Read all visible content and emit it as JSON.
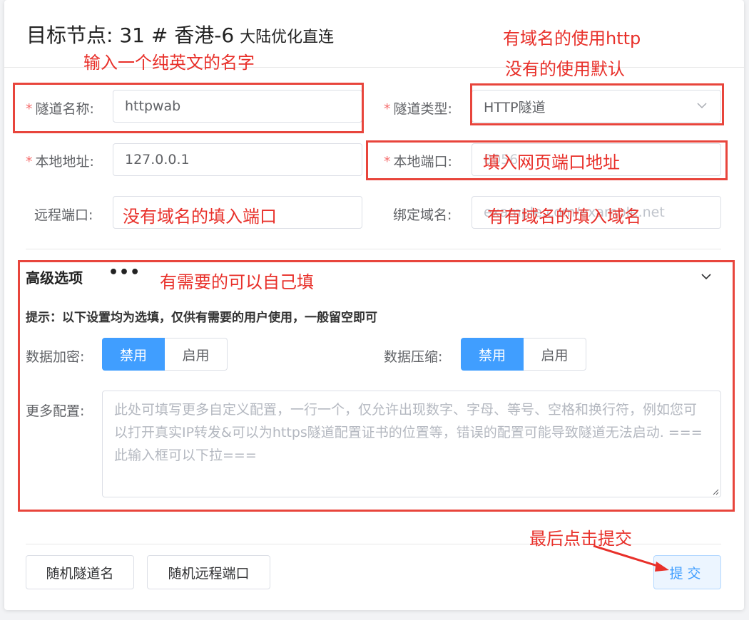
{
  "header": {
    "title": "目标节点: 31 # 香港-6",
    "subtitle": "大陆优化直连"
  },
  "form": {
    "tunnel_name_label": "隧道名称:",
    "tunnel_name_value": "httpwab",
    "tunnel_type_label": "隧道类型:",
    "tunnel_type_value": "HTTP隧道",
    "local_addr_label": "本地地址:",
    "local_addr_value": "127.0.0.1",
    "local_port_label": "本地端口:",
    "local_port_value": "8056",
    "remote_port_label": "远程端口:",
    "remote_port_placeholder": "",
    "domain_label": "绑定域名:",
    "domain_placeholder": "example.com/example.net"
  },
  "advanced": {
    "title": "高级选项",
    "dots": "•••",
    "tip": "提示：以下设置均为选填，仅供有需要的用户使用，一般留空即可",
    "encrypt_label": "数据加密:",
    "compress_label": "数据压缩:",
    "disable_label": "禁用",
    "enable_label": "启用",
    "encrypt_selected": "禁用",
    "compress_selected": "禁用",
    "more_config_label": "更多配置:",
    "more_config_placeholder": "此处可填写更多自定义配置，一行一个，仅允许出现数字、字母、等号、空格和换行符，例如您可以打开真实IP转发&可以为https隧道配置证书的位置等，错误的配置可能导致隧道无法启动. ===此输入框可以下拉==="
  },
  "actions": {
    "random_name": "随机隧道名",
    "random_port": "随机远程端口",
    "submit": "提交"
  },
  "annotations": {
    "name_note": "输入一个纯英文的名字",
    "type_note_1": "有域名的使用http",
    "type_note_2": "没有的使用默认",
    "port_note": "填入网页端口地址",
    "remote_note": "没有域名的填入端口",
    "domain_note": "有有域名的填入域名",
    "adv_note": "有需要的可以自己填",
    "submit_note": "最后点击提交"
  },
  "colors": {
    "accent": "#409eff",
    "annotation_red": "#e8302a",
    "required": "#f56c6c"
  }
}
